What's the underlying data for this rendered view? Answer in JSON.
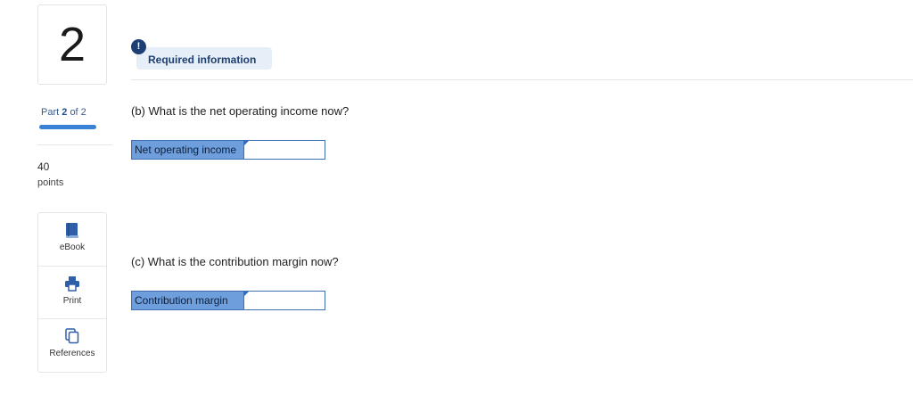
{
  "question": {
    "number": "2"
  },
  "progress": {
    "part_word": "Part",
    "part_current": "2",
    "part_of": "of 2",
    "fraction_complete": 1.0
  },
  "points": {
    "value": "40",
    "label": "points"
  },
  "tools": {
    "ebook_label": "eBook",
    "print_label": "Print",
    "references_label": "References"
  },
  "header": {
    "badge": "!",
    "required_info": "Required information"
  },
  "part_b": {
    "question_text": "(b) What is the net operating income now?",
    "field_label": "Net operating income",
    "field_value": ""
  },
  "part_c": {
    "question_text": "(c) What is the contribution margin now?",
    "field_label": "Contribution margin",
    "field_value": ""
  },
  "colors": {
    "accent": "#3a82d6",
    "label_fill": "#6e9fdc",
    "badge": "#1d3f73",
    "pill": "#e6eef8"
  }
}
